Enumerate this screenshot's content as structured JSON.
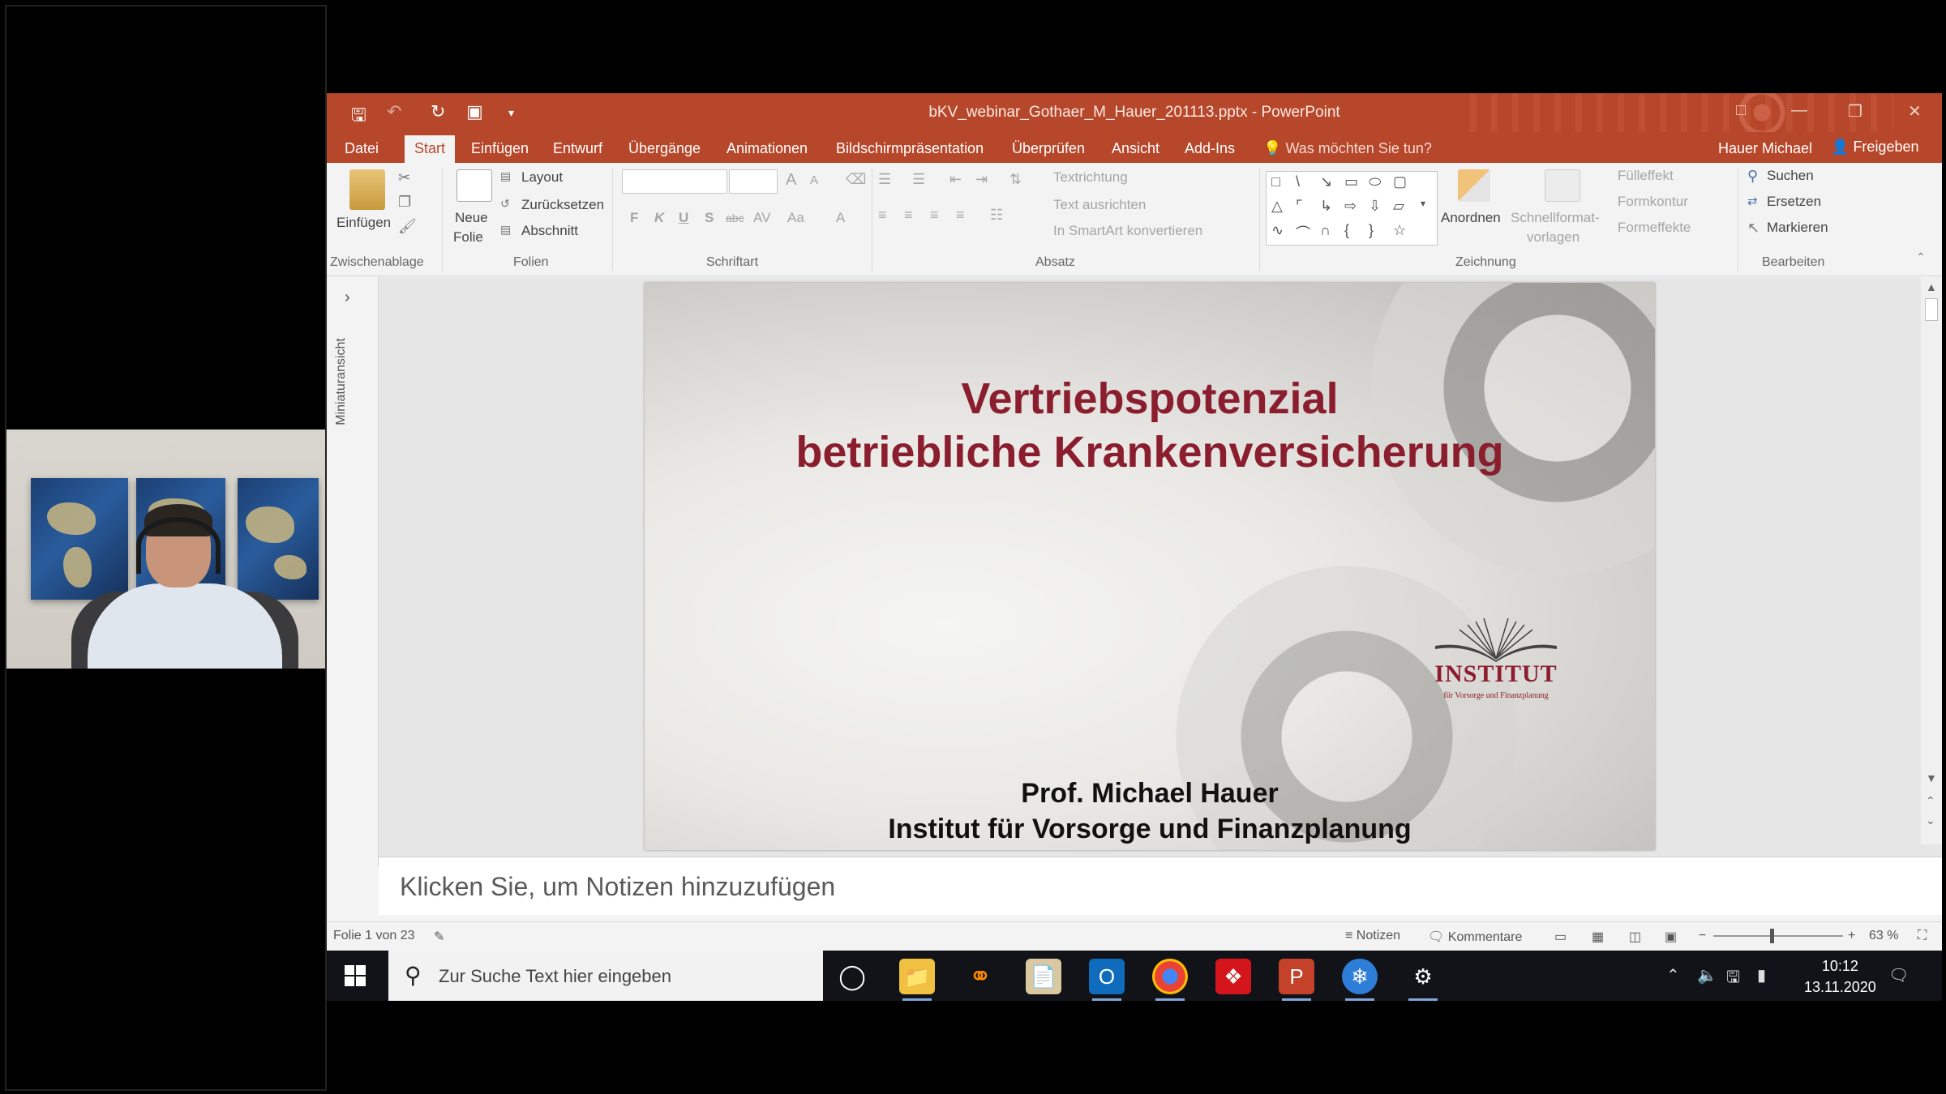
{
  "window": {
    "title": "bKV_webinar_Gothaer_M_Hauer_201113.pptx - PowerPoint"
  },
  "tabs": [
    "Datei",
    "Start",
    "Einfügen",
    "Entwurf",
    "Übergänge",
    "Animationen",
    "Bildschirmpräsentation",
    "Überprüfen",
    "Ansicht",
    "Add-Ins"
  ],
  "active_tab": "Start",
  "tell_me": "Was möchten Sie tun?",
  "user": "Hauer Michael",
  "share": "Freigeben",
  "ribbon": {
    "clipboard": {
      "paste": "Einfügen",
      "group": "Zwischenablage"
    },
    "slides": {
      "new_slide_1": "Neue",
      "new_slide_2": "Folie",
      "layout": "Layout",
      "reset": "Zurücksetzen",
      "section": "Abschnitt",
      "group": "Folien"
    },
    "font": {
      "bold": "F",
      "italic": "K",
      "underline": "U",
      "strike": "S",
      "abc": "abc",
      "spacing": "AV",
      "case": "Aa",
      "color": "A",
      "grow": "A",
      "shrink": "A",
      "group": "Schriftart"
    },
    "paragraph": {
      "text_direction": "Textrichtung",
      "align_text": "Text ausrichten",
      "smartart": "In SmartArt konvertieren",
      "group": "Absatz"
    },
    "drawing": {
      "arrange": "Anordnen",
      "quick_styles_1": "Schnellformat-",
      "quick_styles_2": "vorlagen",
      "fill": "Fülleffekt",
      "outline": "Formkontur",
      "effects": "Formeffekte",
      "group": "Zeichnung"
    },
    "editing": {
      "find": "Suchen",
      "replace": "Ersetzen",
      "select": "Markieren",
      "group": "Bearbeiten"
    }
  },
  "thumbnail_pane": {
    "label": "Miniaturansicht"
  },
  "slide": {
    "title_line1": "Vertriebspotenzial",
    "title_line2": "betriebliche Krankenversicherung",
    "author": "Prof. Michael Hauer",
    "institute": "Institut für Vorsorge und Finanzplanung",
    "logo_text": "INSTITUT",
    "logo_small": "für Vorsorge und Finanzplanung"
  },
  "notes_placeholder": "Klicken Sie, um Notizen hinzuzufügen",
  "status": {
    "slide_count": "Folie 1 von 23",
    "notes": "Notizen",
    "comments": "Kommentare",
    "zoom": "63 %",
    "zoom_level": 0.45
  },
  "taskbar": {
    "search_placeholder": "Zur Suche Text hier eingeben",
    "time": "10:12",
    "date": "13.11.2020"
  },
  "colors": {
    "accent": "#b7472a",
    "slide_title": "#8b1e2e"
  }
}
